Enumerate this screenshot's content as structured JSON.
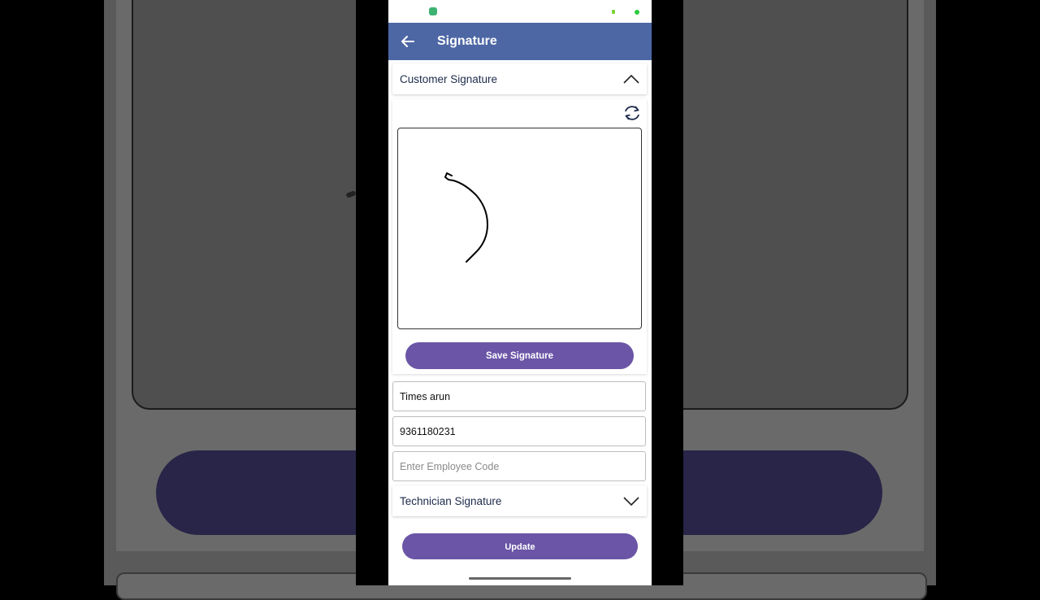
{
  "app": {
    "title": "Signature",
    "accent_color": "#4d67a5",
    "button_color": "#6a55a6"
  },
  "customer_section": {
    "label": "Customer Signature",
    "expanded": true
  },
  "signature_canvas": {
    "has_stroke": true
  },
  "buttons": {
    "save_label": "Save Signature",
    "update_label": "Update"
  },
  "fields": {
    "name_value": "Times arun",
    "phone_value": "9361180231",
    "employee_placeholder": "Enter Employee Code"
  },
  "technician_section": {
    "label": "Technician Signature",
    "expanded": false
  },
  "icons": [
    "back-arrow-icon",
    "chevron-up-icon",
    "refresh-icon",
    "chevron-down-icon"
  ]
}
